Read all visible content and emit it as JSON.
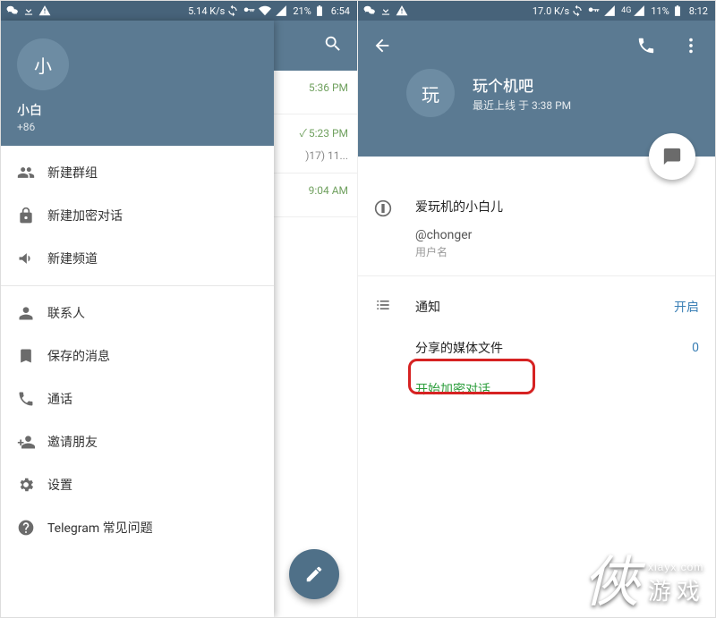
{
  "left": {
    "status": {
      "speed": "5.14 K/s",
      "battery": "21%",
      "time": "6:54"
    },
    "drawer": {
      "avatar_letter": "小",
      "name": "小白",
      "phone": "+86",
      "items": [
        {
          "id": "new-group",
          "label": "新建群组"
        },
        {
          "id": "new-secret",
          "label": "新建加密对话"
        },
        {
          "id": "new-channel",
          "label": "新建频道"
        }
      ],
      "items2": [
        {
          "id": "contacts",
          "label": "联系人"
        },
        {
          "id": "saved",
          "label": "保存的消息"
        },
        {
          "id": "calls",
          "label": "通话"
        },
        {
          "id": "invite",
          "label": "邀请朋友"
        },
        {
          "id": "settings",
          "label": "设置"
        },
        {
          "id": "faq",
          "label": "Telegram 常见问题"
        }
      ]
    },
    "behind": {
      "msg1": {
        "time": "5:36 PM"
      },
      "msg2": {
        "time": "5:23 PM",
        "snippet": ")17) 11..."
      },
      "msg3": {
        "time": "9:04 AM"
      }
    }
  },
  "right": {
    "status": {
      "speed": "17.0 K/s",
      "net": "4G",
      "battery": "11%",
      "time": "8:12"
    },
    "header": {
      "avatar_letter": "玩",
      "title": "玩个机吧",
      "subtitle": "最近上线 于 3:38 PM"
    },
    "profile": {
      "bio": "爱玩机的小白儿",
      "username": "@chonger",
      "username_label": "用户名",
      "notifications_label": "通知",
      "notifications_value": "开启",
      "shared_label": "分享的媒体文件",
      "shared_value": "0",
      "start_secret": "开始加密对话"
    }
  },
  "watermark": {
    "glyph": "俠",
    "site": "xiayx.com",
    "word": "游戏"
  }
}
